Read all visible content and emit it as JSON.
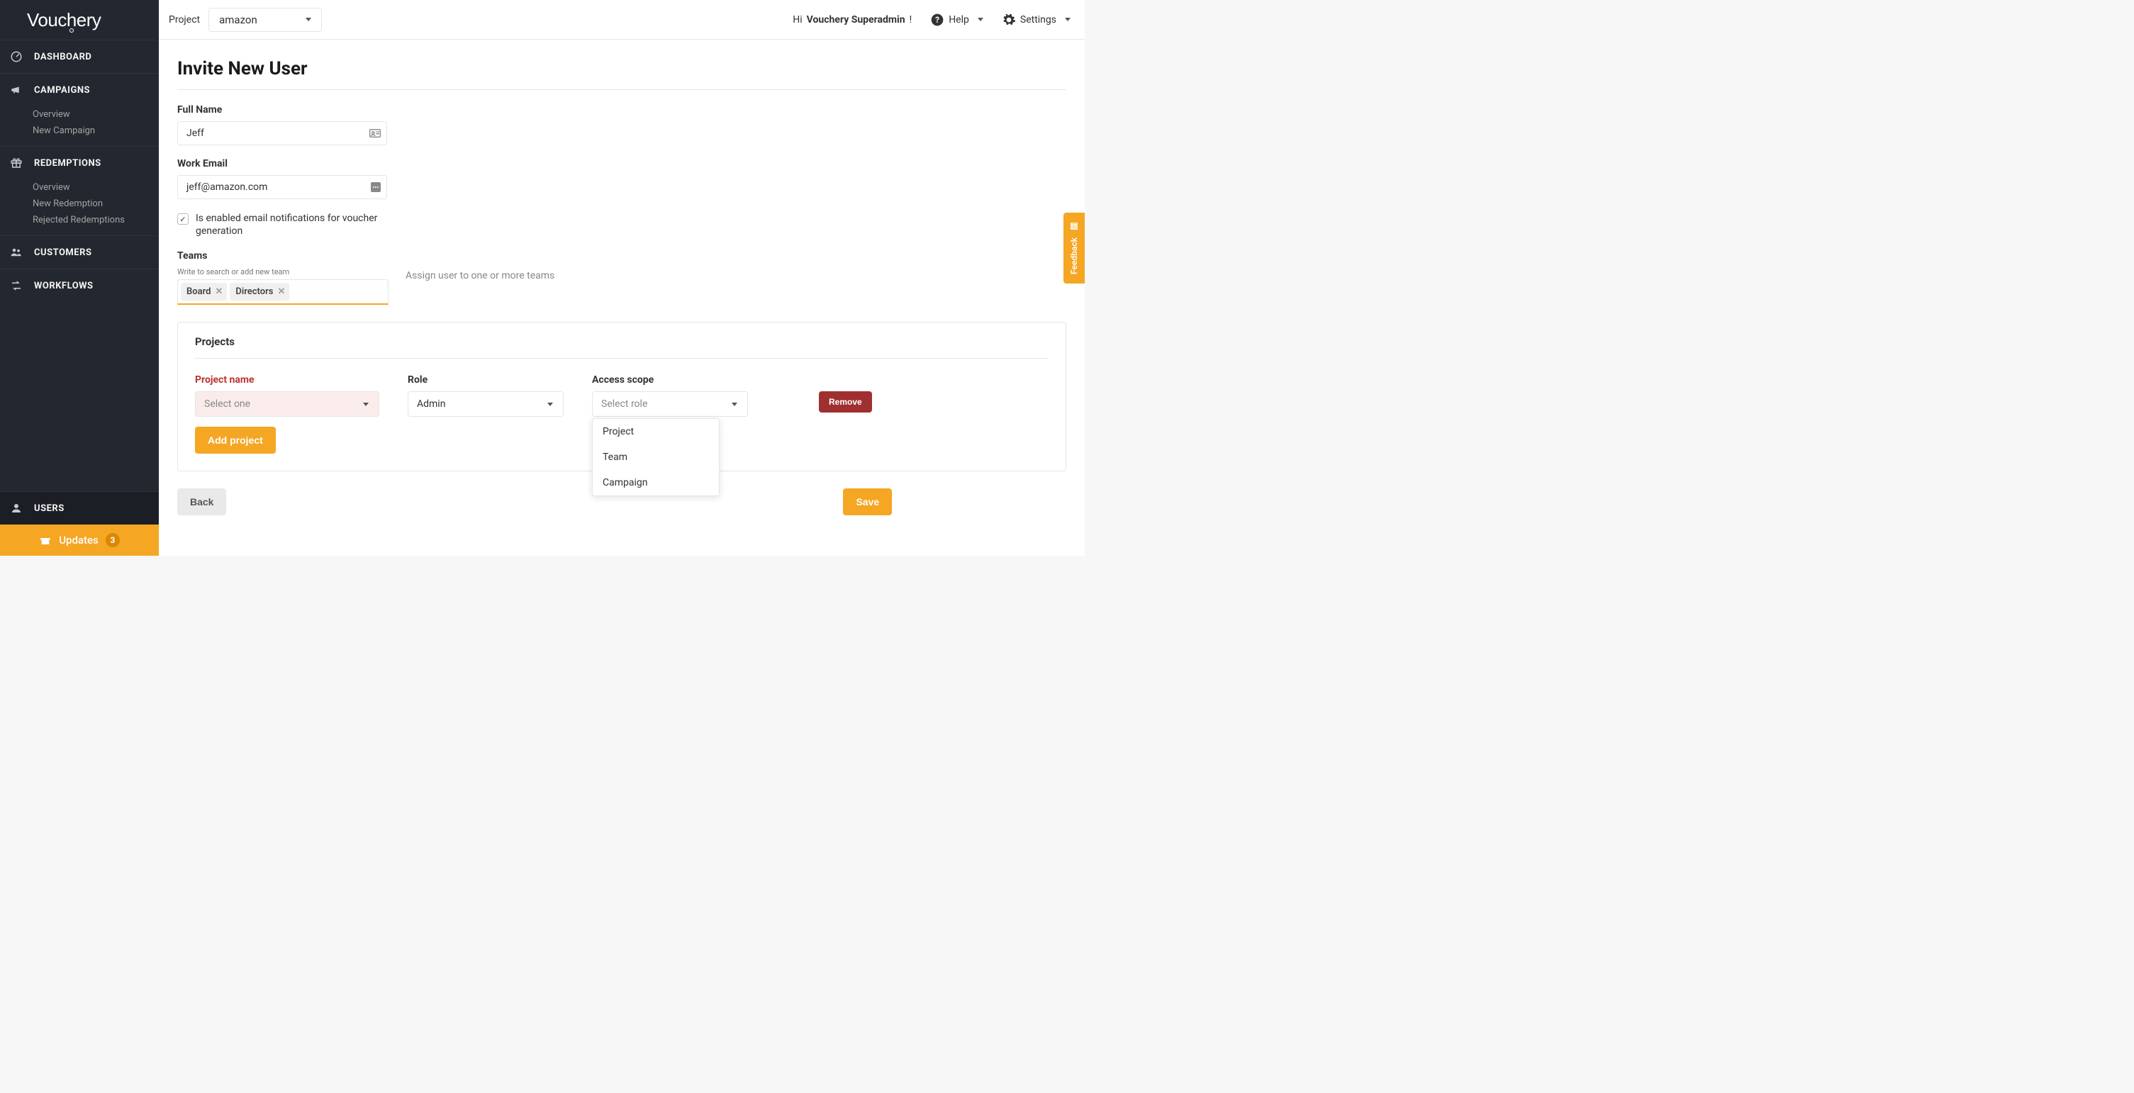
{
  "brand": "Vouchery",
  "topbar": {
    "project_label": "Project",
    "project_value": "amazon",
    "greeting_prefix": "Hi ",
    "greeting_name": "Vouchery Superadmin",
    "greeting_suffix": "!",
    "help_label": "Help",
    "settings_label": "Settings"
  },
  "sidebar": {
    "items": [
      {
        "label": "DASHBOARD"
      },
      {
        "label": "CAMPAIGNS",
        "sub": [
          "Overview",
          "New Campaign"
        ]
      },
      {
        "label": "REDEMPTIONS",
        "sub": [
          "Overview",
          "New Redemption",
          "Rejected Redemptions"
        ]
      },
      {
        "label": "CUSTOMERS"
      },
      {
        "label": "WORKFLOWS"
      }
    ],
    "users_label": "USERS",
    "updates_label": "Updates",
    "updates_count": "3"
  },
  "page": {
    "title": "Invite New User",
    "fullname_label": "Full Name",
    "fullname_value": "Jeff",
    "email_label": "Work Email",
    "email_value": "jeff@amazon.com",
    "checkbox_label": "Is enabled email notifications for voucher generation",
    "checkbox_checked": true,
    "teams_label": "Teams",
    "teams_hint": "Write to search or add new team",
    "teams_tokens": [
      "Board",
      "Directors"
    ],
    "assign_hint": "Assign user to one or more teams"
  },
  "projects": {
    "header": "Projects",
    "cols": {
      "name": "Project name",
      "role": "Role",
      "scope": "Access scope"
    },
    "row": {
      "name_placeholder": "Select one",
      "role_value": "Admin",
      "scope_placeholder": "Select role"
    },
    "scope_options": [
      "Project",
      "Team",
      "Campaign"
    ],
    "add_label": "Add project",
    "remove_label": "Remove"
  },
  "actions": {
    "back": "Back",
    "save": "Save"
  },
  "feedback_label": "Feedback"
}
